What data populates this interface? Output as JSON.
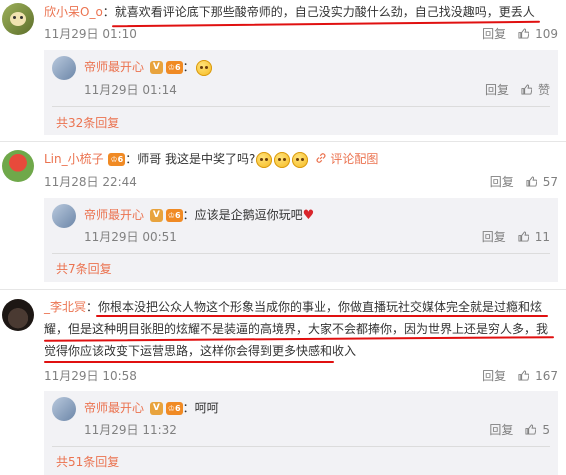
{
  "comments": [
    {
      "user": "欣小呆O_o",
      "text": "：就喜欢看评论底下那些酸帝师的，自己没实力酸什么劲，自己找没趣吗，更丢人",
      "time": "11月29日 01:10",
      "reply_label": "回复",
      "likes": "109",
      "reply": {
        "user": "帝师最开心",
        "vip": "6",
        "text": "：",
        "time": "11月29日 01:14",
        "reply_label": "回复",
        "likes": "赞"
      },
      "more": "共32条回复"
    },
    {
      "user": "Lin_小梳子",
      "vip": "6",
      "text": "：师哥  我这是中奖了吗?",
      "extra_link": "评论配图",
      "time": "11月28日 22:44",
      "reply_label": "回复",
      "likes": "57",
      "reply": {
        "user": "帝师最开心",
        "vip": "6",
        "text": "：应该是企鹅逗你玩吧",
        "time": "11月29日 00:51",
        "reply_label": "回复",
        "likes": "11"
      },
      "more": "共7条回复"
    },
    {
      "user": "_李北冥",
      "text": "：你根本没把公众人物这个形象当成你的事业，你做直播玩社交媒体完全就是过瘾和炫耀，但是这种明目张胆的炫耀不是装逼的高境界，大家不会都捧你，因为世界上还是穷人多，我觉得你应该改变下运营思路，这样你会得到更多快感和收入",
      "time": "11月29日 10:58",
      "reply_label": "回复",
      "likes": "167",
      "reply": {
        "user": "帝师最开心",
        "vip": "6",
        "text": "：呵呵",
        "time": "11月29日 11:32",
        "reply_label": "回复",
        "likes": "5"
      },
      "more": "共51条回复"
    }
  ],
  "colors": {
    "username": "#eb7350",
    "meta": "#808080",
    "reply_bg": "#f2f2f5",
    "annotation": "#e01010"
  }
}
